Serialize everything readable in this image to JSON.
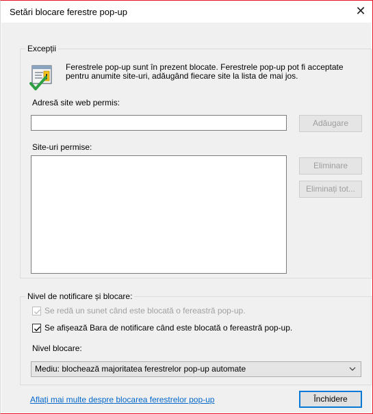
{
  "window": {
    "title": "Setări blocare ferestre pop-up",
    "close_glyph": "✕"
  },
  "exceptions": {
    "legend": "Excepții",
    "info_text": "Ferestrele pop-up sunt în prezent blocate. Ferestrele pop-up pot fi acceptate pentru anumite site-uri, adăugând fiecare site la lista de mai jos.",
    "icon": "info-checkmark-icon",
    "address_label": "Adresă site web permis:",
    "address_value": "",
    "add_button": "Adăugare",
    "allowed_label": "Site-uri permise:",
    "allowed_sites": [],
    "remove_button": "Eliminare",
    "remove_all_button": "Eliminați tot..."
  },
  "notification": {
    "legend": "Nivel de notificare și blocare:",
    "sound_checkbox": {
      "label": "Se redă un sunet când este blocată o fereastră pop-up.",
      "checked": true,
      "enabled": false
    },
    "bar_checkbox": {
      "label": "Se afișează Bara de notificare când este blocată o fereastră pop-up.",
      "checked": true,
      "enabled": true
    },
    "level_label": "Nivel blocare:",
    "level_value": "Mediu: blochează majoritatea ferestrelor pop-up automate"
  },
  "footer": {
    "learn_more_link": "Aflați mai multe despre blocarea ferestrelor pop-up",
    "close_button": "Închidere"
  },
  "colors": {
    "link": "#0066cc",
    "accent": "#0078d7",
    "window_border": "#e81123"
  }
}
